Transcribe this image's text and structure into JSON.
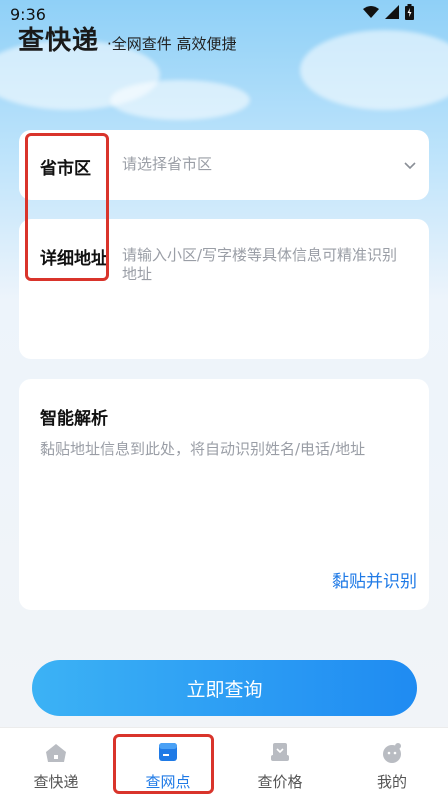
{
  "status_bar": {
    "time": "9:36"
  },
  "header": {
    "logo": "查快递",
    "tagline": "·全网查件 高效便捷"
  },
  "region": {
    "label": "省市区",
    "placeholder": "请选择省市区"
  },
  "detail": {
    "label": "详细地址",
    "placeholder": "请输入小区/写字楼等具体信息可精准识别地址"
  },
  "parse": {
    "title": "智能解析",
    "placeholder": "黏贴地址信息到此处，将自动识别姓名/电话/地址",
    "action": "黏贴并识别"
  },
  "submit_label": "立即查询",
  "tabs": [
    {
      "label": "查快递",
      "icon": "home-icon"
    },
    {
      "label": "查网点",
      "icon": "outlet-icon",
      "active": true
    },
    {
      "label": "查价格",
      "icon": "price-box-icon"
    },
    {
      "label": "我的",
      "icon": "profile-icon"
    }
  ],
  "colors": {
    "accent": "#1f7ae6",
    "highlight": "#d9342b"
  }
}
